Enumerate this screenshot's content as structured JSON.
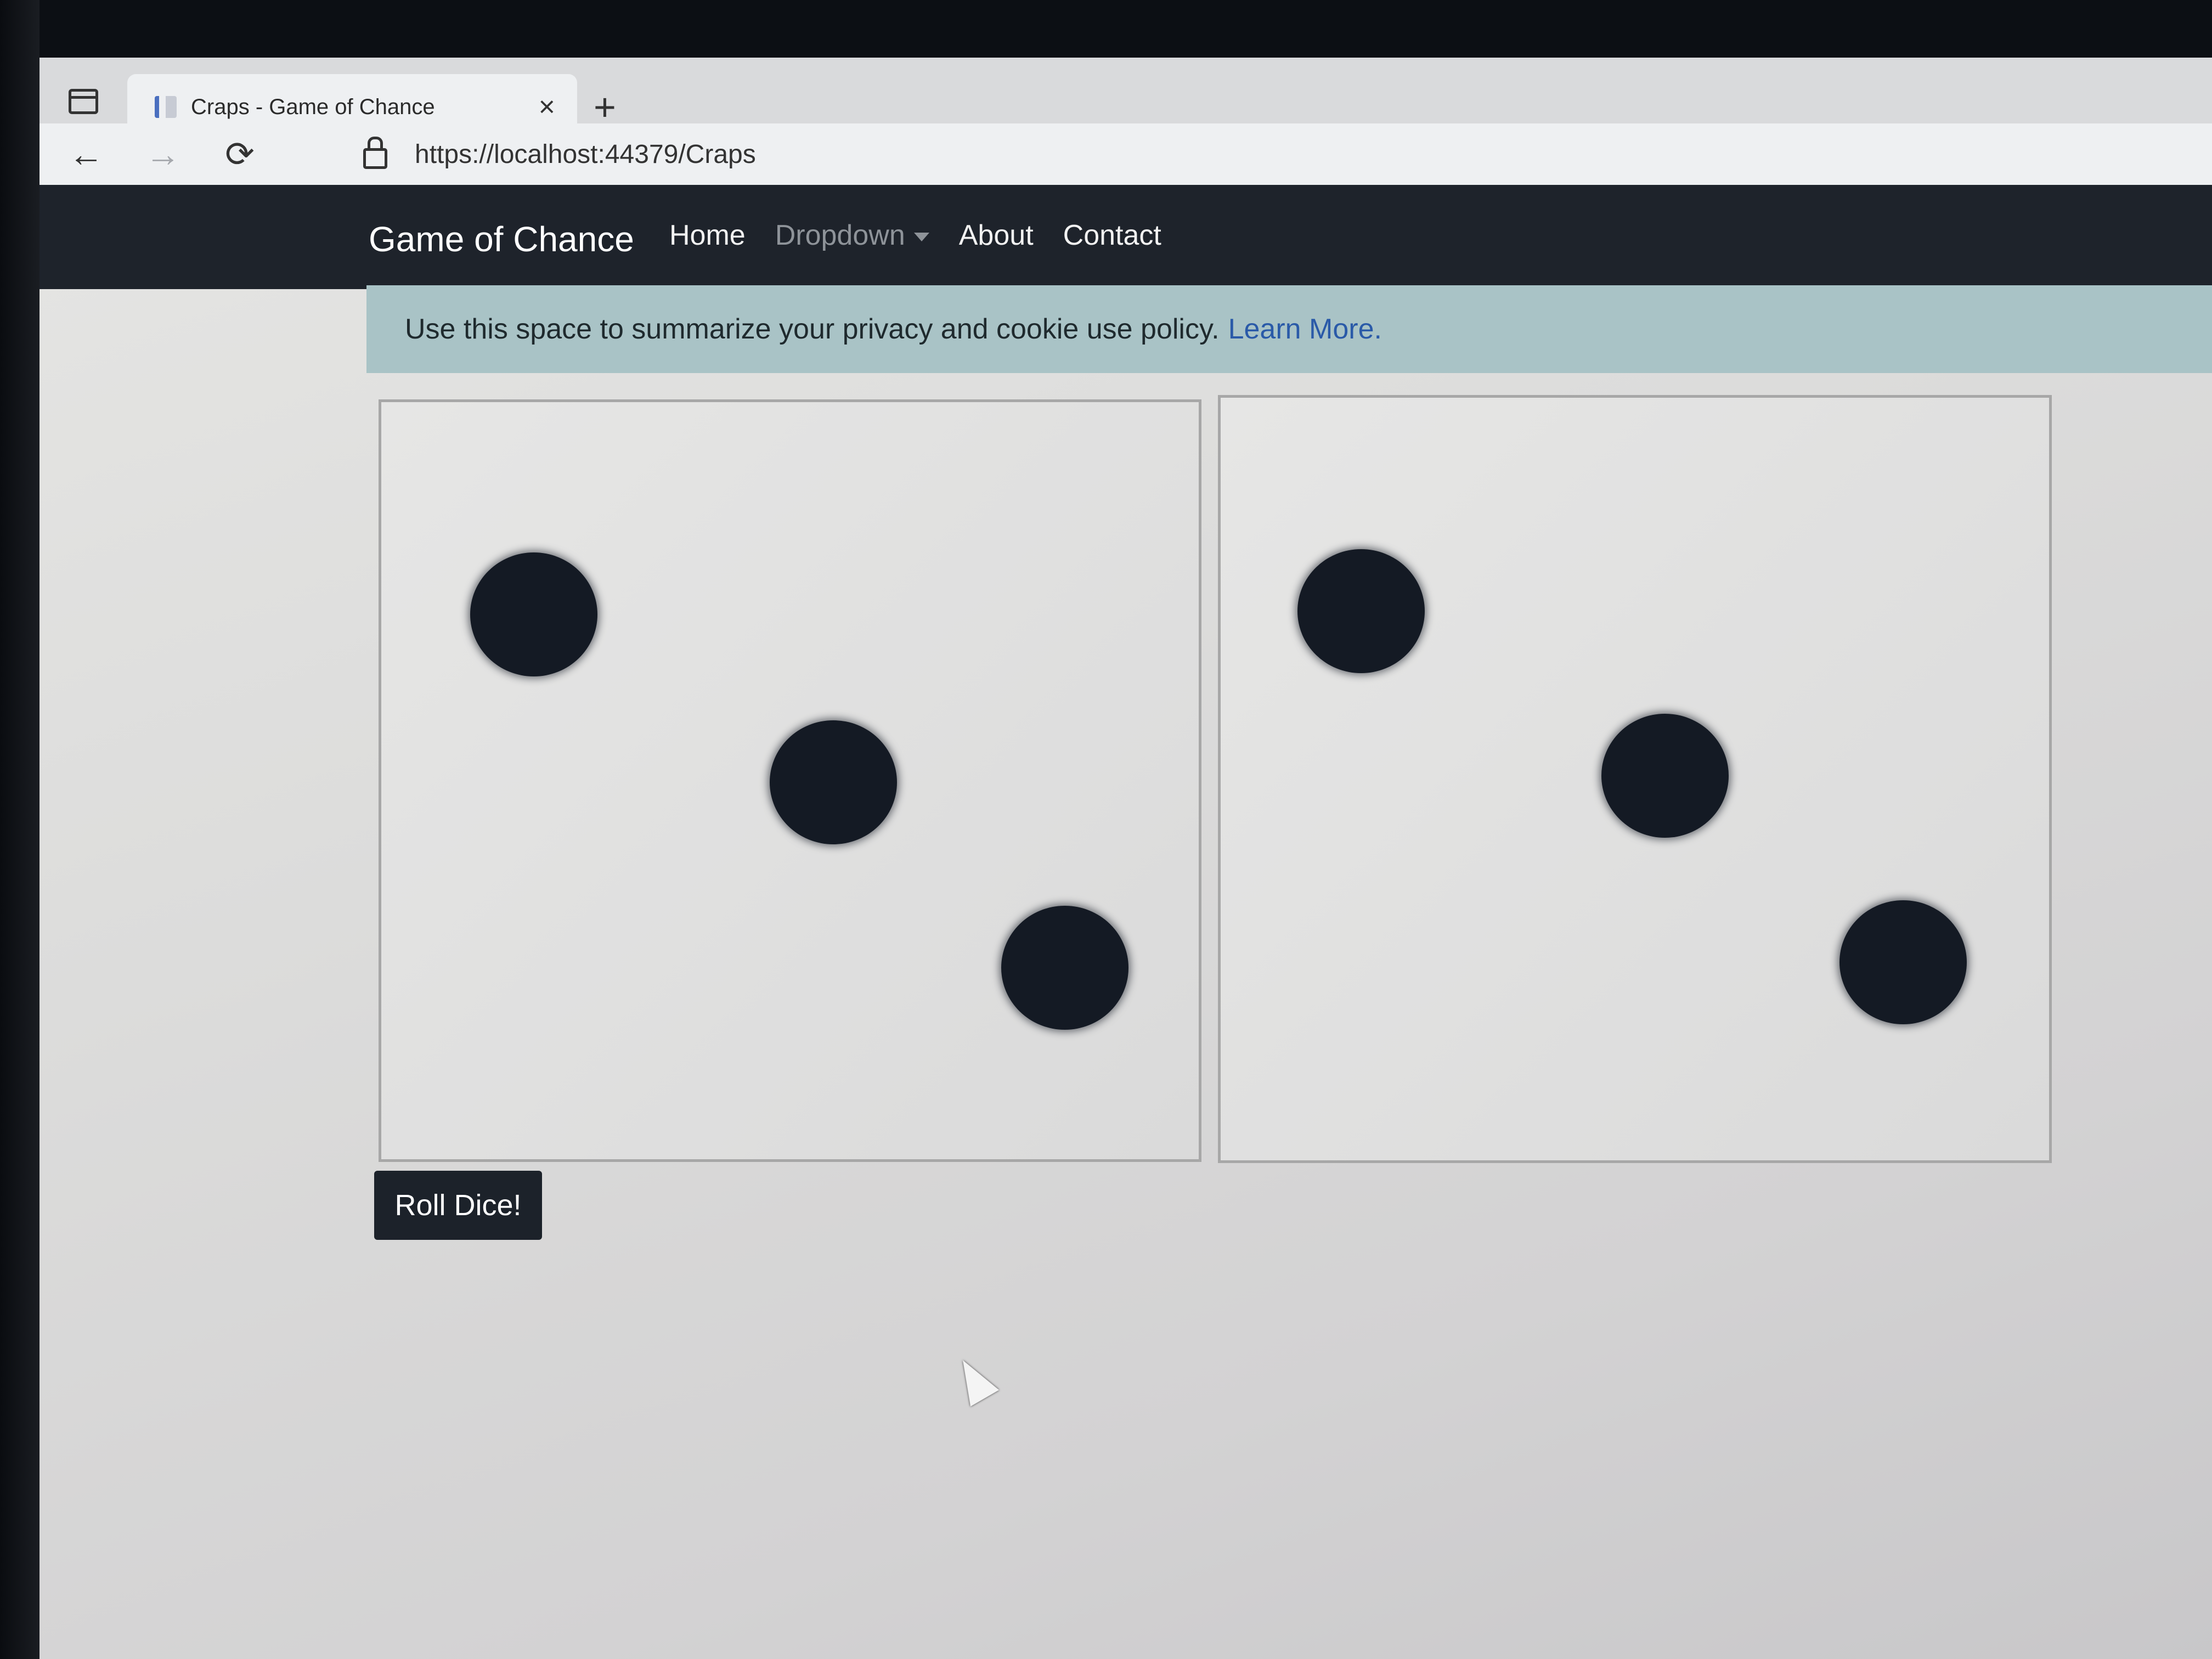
{
  "browser": {
    "tab_title": "Craps - Game of Chance",
    "tab_close_icon": "×",
    "new_tab_icon": "+",
    "back_icon": "←",
    "forward_icon": "→",
    "reload_icon": "⟳",
    "url": "https://localhost:44379/Craps"
  },
  "site_nav": {
    "brand": "Game of Chance",
    "links": [
      "Home",
      "Dropdown",
      "About",
      "Contact"
    ]
  },
  "cookie_notice": {
    "text": "Use this space to summarize your privacy and cookie use policy.",
    "link_text": "Learn More."
  },
  "dice": [
    {
      "value": 3
    },
    {
      "value": 3
    }
  ],
  "roll_button_label": "Roll Dice!",
  "colors": {
    "navbar_bg": "#1e232b",
    "cookie_bg": "#a9c3c6",
    "link": "#2a5aa8",
    "pip": "#141a24",
    "button_bg": "#1c222a"
  }
}
